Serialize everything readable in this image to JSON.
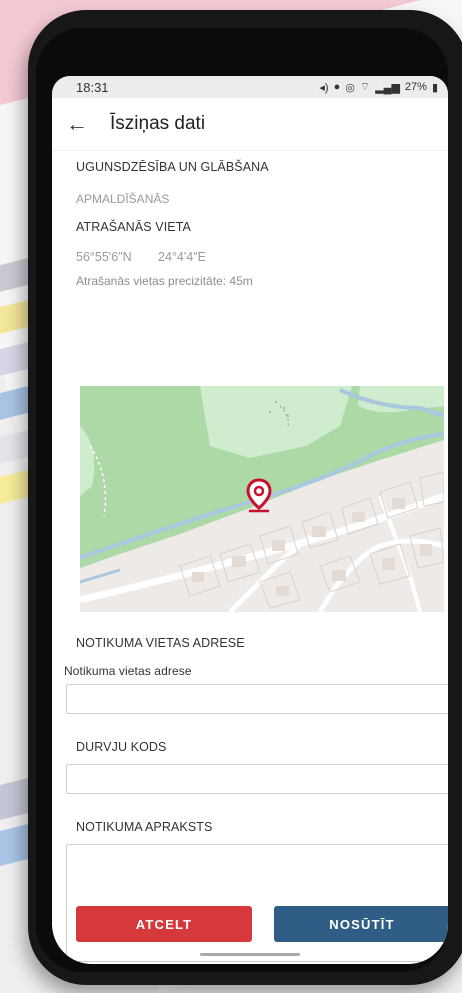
{
  "status_bar": {
    "time": "18:31",
    "battery": "27%"
  },
  "app_bar": {
    "title": "Īsziņas dati"
  },
  "service": {
    "category": "UGUNSDZĒSĪBA UN GLĀBŠANA",
    "subcategory": "APMALDĪŠANĀS"
  },
  "location": {
    "heading": "ATRAŠANĀS VIETA",
    "lat": "56°55'6\"N",
    "lon": "24°4'4\"E",
    "accuracy": "Atrašanās vietas precizitāte: 45m"
  },
  "address": {
    "heading": "NOTIKUMA VIETAS ADRESE",
    "field_label": "Notikuma vietas adrese",
    "value": ""
  },
  "door_code": {
    "heading": "DURVJU KODS",
    "value": ""
  },
  "description": {
    "heading": "NOTIKUMA APRAKSTS",
    "value": ""
  },
  "buttons": {
    "cancel": "ATCELT",
    "send": "NOSŪTĪT"
  },
  "colors": {
    "cancel": "#d6393c",
    "send": "#2f5d86",
    "map_park": "#cfeccf",
    "map_forest": "#add9a7",
    "river": "#a9c7df",
    "pin": "#c8102e"
  }
}
